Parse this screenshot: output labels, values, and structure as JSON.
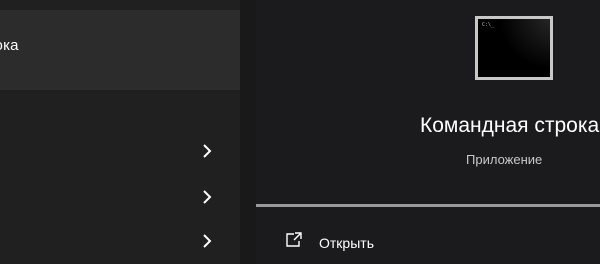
{
  "results": {
    "best_match_label": "рока",
    "chevrons": [
      "chevron-right-icon",
      "chevron-right-icon",
      "chevron-right-icon"
    ]
  },
  "details": {
    "icon": "command-prompt-icon",
    "icon_prompt_text": "C:\\_",
    "title": "Командная строка",
    "subtitle": "Приложение",
    "actions": [
      {
        "icon": "open-external-icon",
        "label": "Открыть"
      }
    ]
  },
  "colors": {
    "background": "#202020",
    "selected_item": "#2c2c2c",
    "details_background": "#1b1a1d",
    "text_primary": "#ffffff",
    "text_secondary": "#c9c9c9",
    "section_line": "#9a9a9a"
  }
}
